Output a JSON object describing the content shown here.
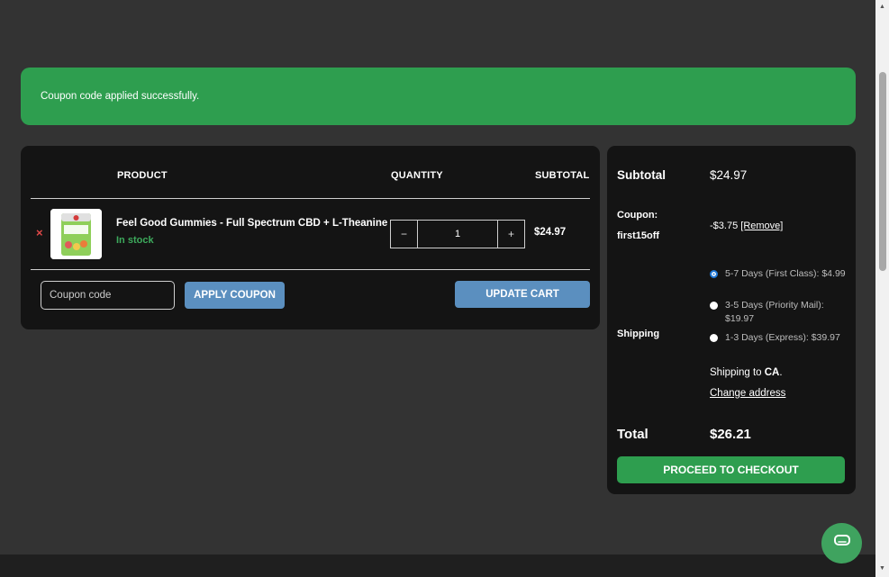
{
  "notice": {
    "message": "Coupon code applied successfully."
  },
  "cart": {
    "headers": {
      "product": "PRODUCT",
      "quantity": "QUANTITY",
      "subtotal": "SUBTOTAL"
    },
    "item": {
      "remove_symbol": "×",
      "name": "Feel Good Gummies - Full Spectrum CBD + L-Theanine",
      "stock": "In stock",
      "quantity": "1",
      "decrement": "−",
      "increment": "+",
      "subtotal": "$24.97",
      "thumbnail_text": "FEEL GOOD GUMMIES"
    },
    "coupon_placeholder": "Coupon code",
    "apply_coupon_label": "APPLY COUPON",
    "update_cart_label": "UPDATE CART"
  },
  "totals": {
    "subtotal_label": "Subtotal",
    "subtotal_value": "$24.97",
    "coupon_label": "Coupon:",
    "coupon_code": "first15off",
    "coupon_discount": "-$3.75",
    "coupon_remove": "[Remove]",
    "shipping_label": "Shipping",
    "shipping_options": [
      {
        "label": "5-7 Days (First Class): $4.99",
        "checked": true
      },
      {
        "label": "3-5 Days (Priority Mail): $19.97",
        "checked": false
      },
      {
        "label": "1-3 Days (Express): $39.97",
        "checked": false
      }
    ],
    "shipping_to_prefix": "Shipping to ",
    "shipping_to_region": "CA",
    "shipping_to_suffix": ".",
    "change_address": "Change address",
    "total_label": "Total",
    "total_value": "$26.21",
    "checkout_label": "PROCEED TO CHECKOUT"
  },
  "colors": {
    "page_bg": "#333333",
    "panel_bg": "#141414",
    "success_green": "#2e9e4f",
    "button_blue": "#5b8fbf",
    "remove_red": "#e04848"
  },
  "icons": {
    "remove": "close-icon",
    "chat": "chat-bubble-icon"
  }
}
